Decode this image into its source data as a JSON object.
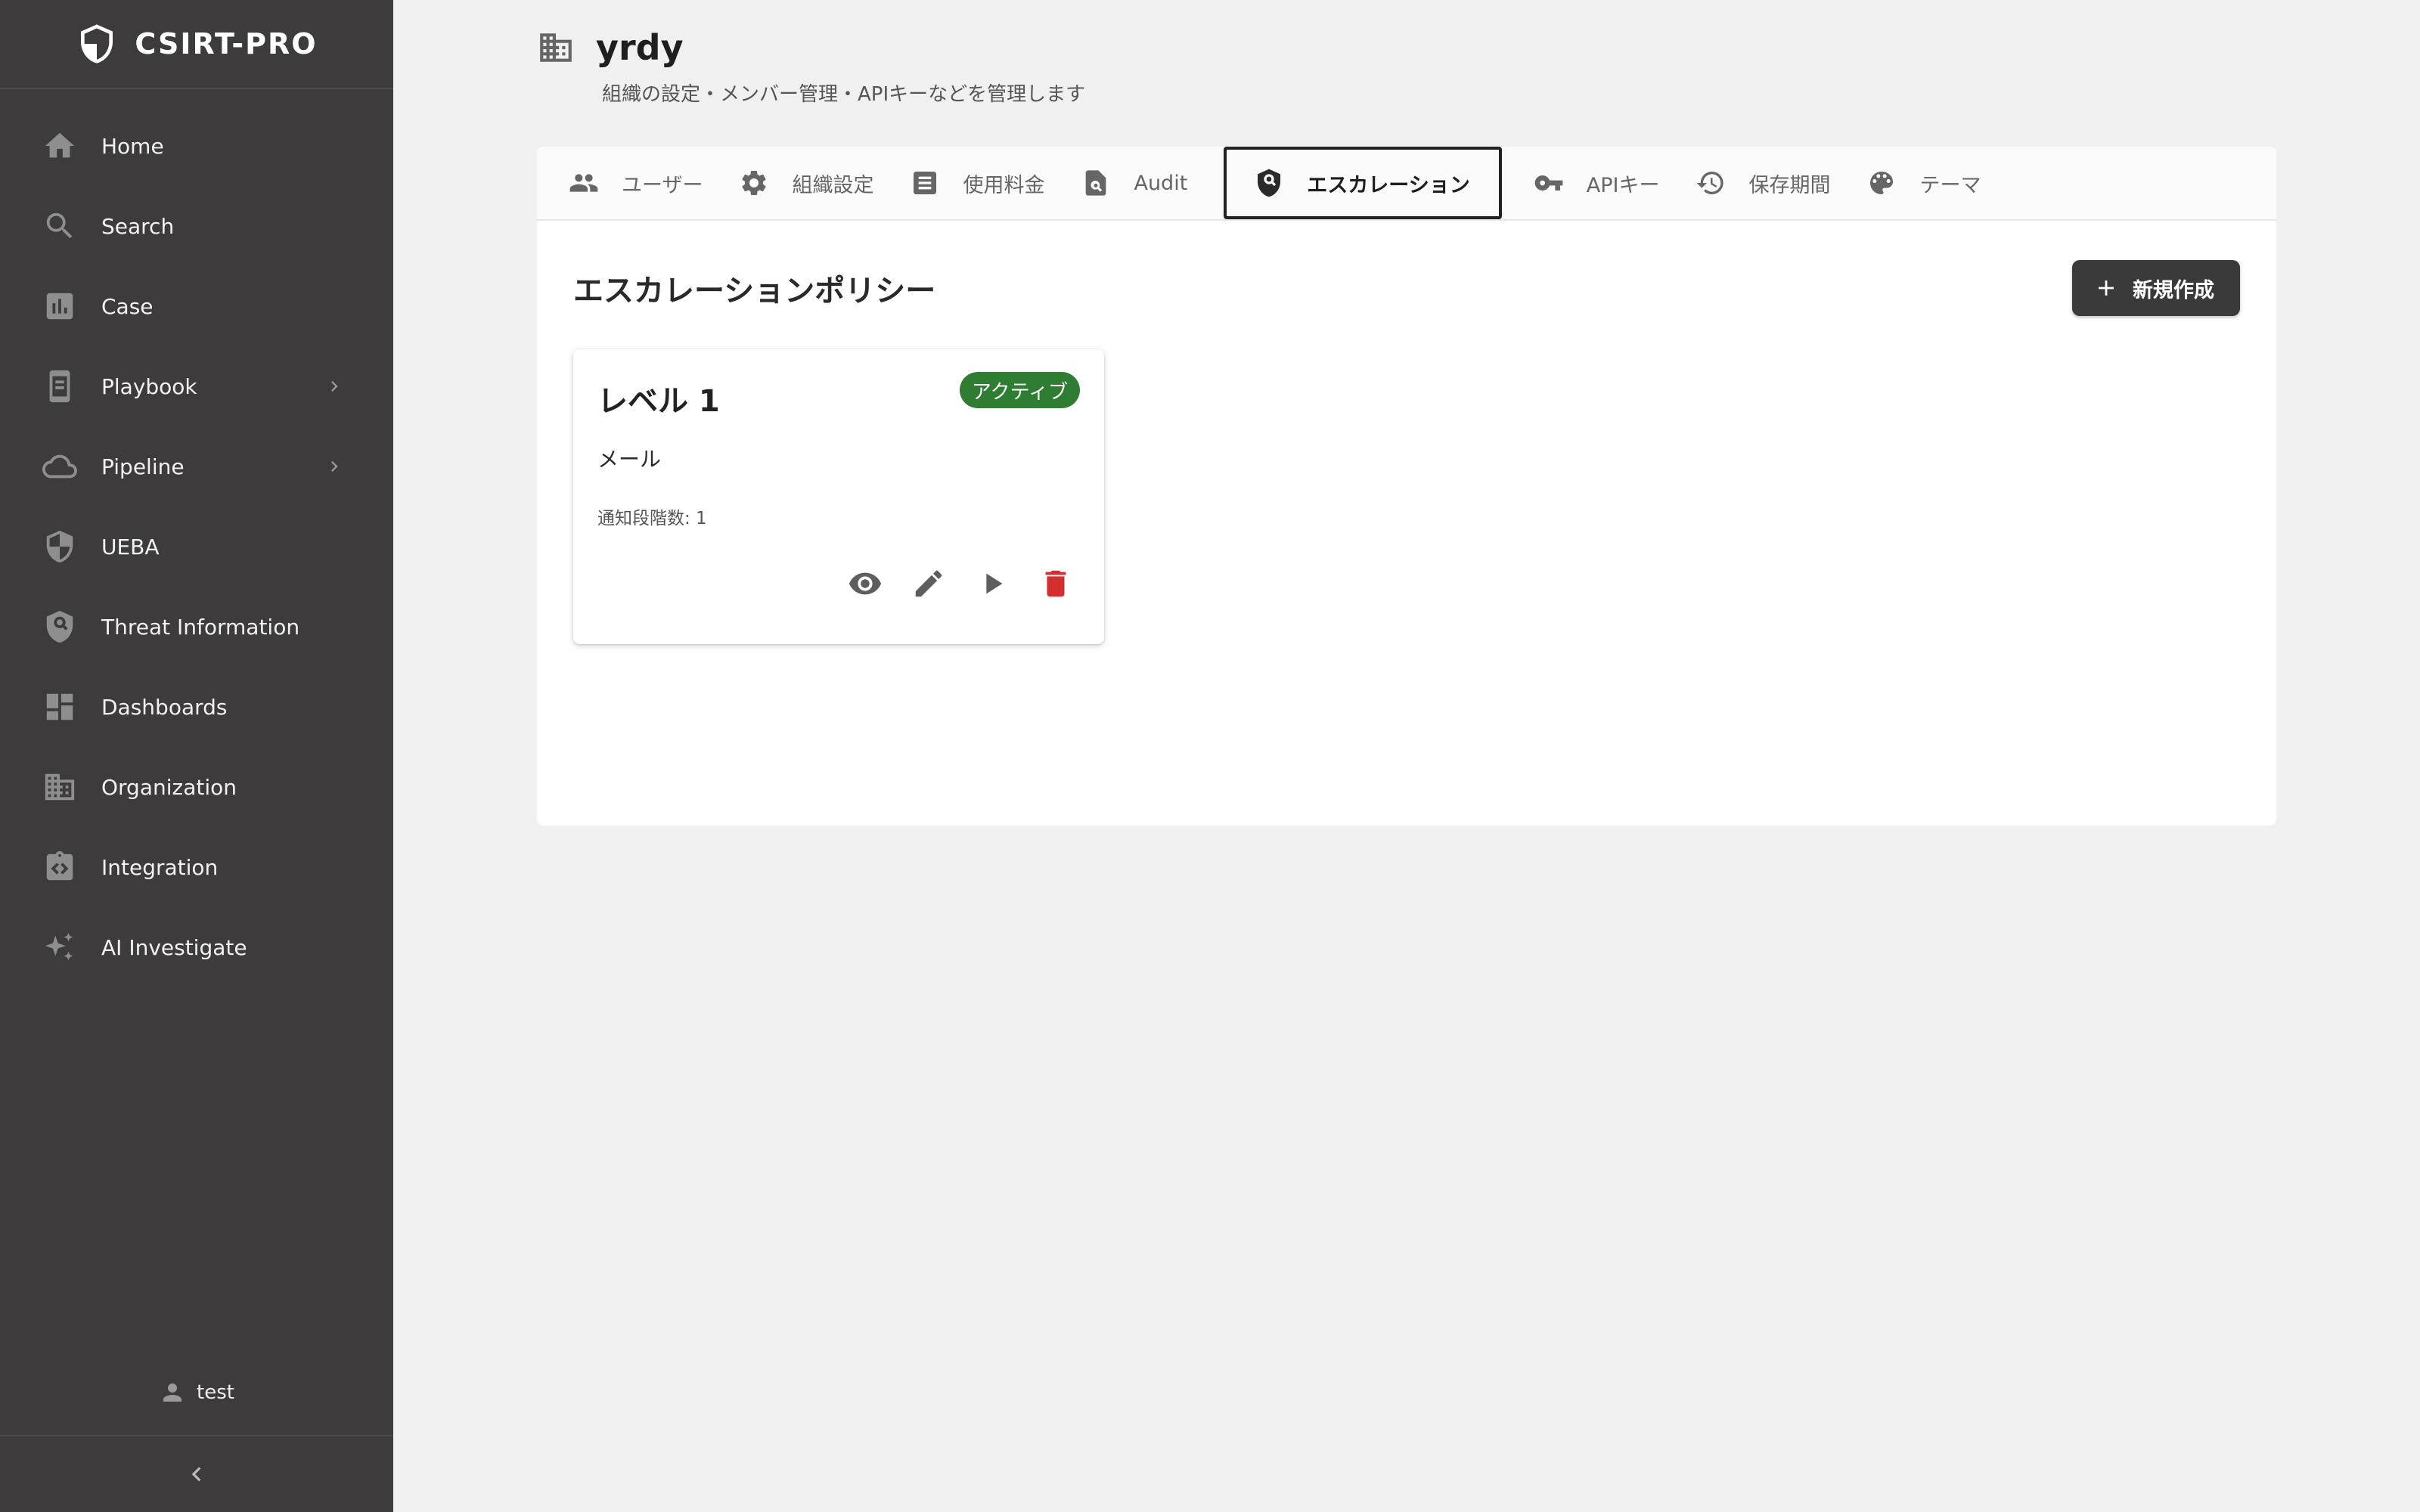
{
  "app": {
    "name": "CSIRT-PRO"
  },
  "sidebar": {
    "items": [
      {
        "label": "Home",
        "icon": "home-icon",
        "has_submenu": false
      },
      {
        "label": "Search",
        "icon": "search-icon",
        "has_submenu": false
      },
      {
        "label": "Case",
        "icon": "chart-icon",
        "has_submenu": false
      },
      {
        "label": "Playbook",
        "icon": "playbook-icon",
        "has_submenu": true
      },
      {
        "label": "Pipeline",
        "icon": "cloud-icon",
        "has_submenu": true
      },
      {
        "label": "UEBA",
        "icon": "shield-icon",
        "has_submenu": false
      },
      {
        "label": "Threat Information",
        "icon": "shield-search-icon",
        "has_submenu": false
      },
      {
        "label": "Dashboards",
        "icon": "dashboard-icon",
        "has_submenu": false
      },
      {
        "label": "Organization",
        "icon": "building-icon",
        "has_submenu": false
      },
      {
        "label": "Integration",
        "icon": "integration-icon",
        "has_submenu": false
      },
      {
        "label": "AI Investigate",
        "icon": "sparkle-icon",
        "has_submenu": false
      }
    ],
    "user": {
      "name": "test",
      "icon": "person-icon"
    }
  },
  "header": {
    "title": "yrdy",
    "subtitle": "組織の設定・メンバー管理・APIキーなどを管理します",
    "icon": "building-icon"
  },
  "tabs": [
    {
      "label": "ユーザー",
      "icon": "people-icon",
      "active": false
    },
    {
      "label": "組織設定",
      "icon": "gear-icon",
      "active": false
    },
    {
      "label": "使用料金",
      "icon": "receipt-icon",
      "active": false
    },
    {
      "label": "Audit",
      "icon": "audit-icon",
      "active": false
    },
    {
      "label": "エスカレーション",
      "icon": "shield-search-icon",
      "active": true
    },
    {
      "label": "APIキー",
      "icon": "key-icon",
      "active": false
    },
    {
      "label": "保存期間",
      "icon": "history-icon",
      "active": false
    },
    {
      "label": "テーマ",
      "icon": "palette-icon",
      "active": false
    }
  ],
  "section": {
    "title": "エスカレーションポリシー",
    "new_button_label": "新規作成"
  },
  "policies": [
    {
      "title": "レベル 1",
      "status": "アクティブ",
      "type": "メール",
      "meta": "通知段階数: 1"
    }
  ],
  "colors": {
    "sidebar_bg": "#3d3b3b",
    "page_bg": "#f0f0f0",
    "active_badge": "#2e7d32",
    "delete": "#d32f2f",
    "primary_button": "#3a3a3a"
  }
}
